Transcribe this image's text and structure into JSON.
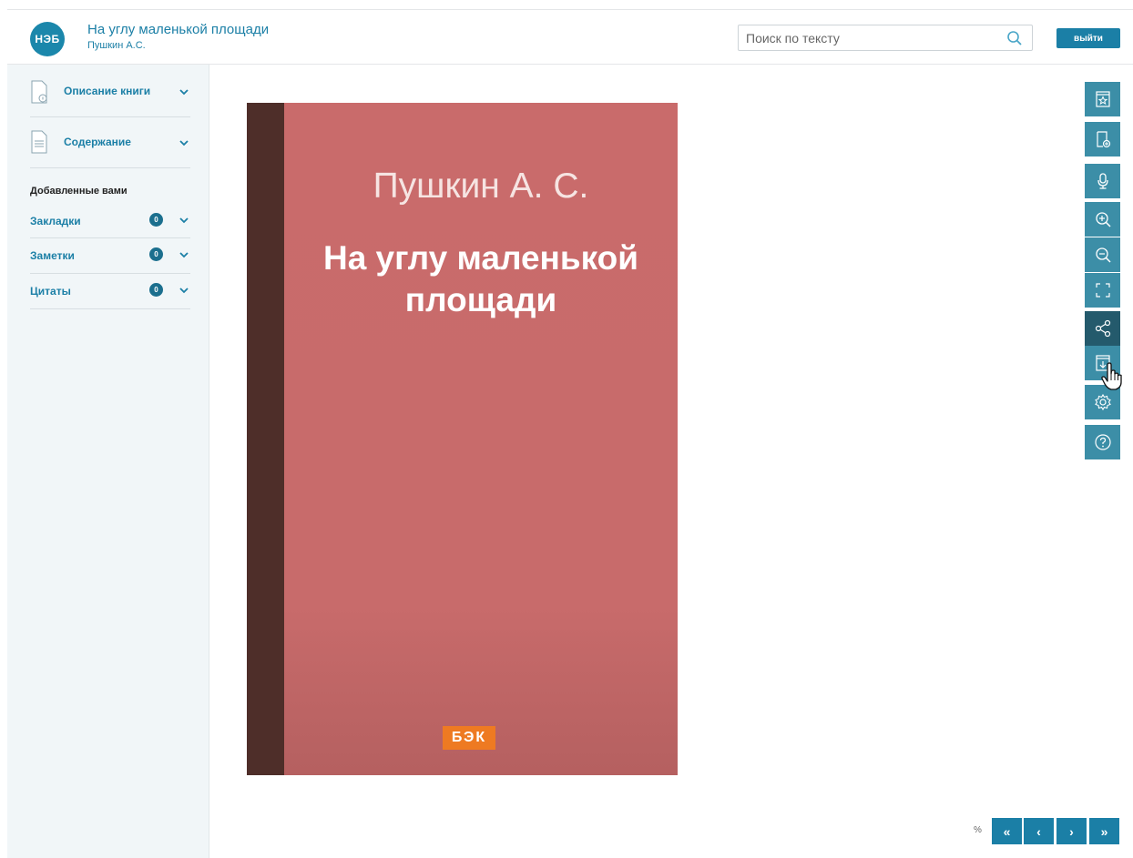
{
  "header": {
    "logo_text": "НЭБ",
    "book_title": "На углу маленькой площади",
    "book_author": "Пушкин А.С.",
    "search_placeholder": "Поиск по тексту",
    "logout_label": "выйти"
  },
  "sidebar": {
    "sections": [
      {
        "label": "Описание книги",
        "icon": "document-info-icon"
      },
      {
        "label": "Содержание",
        "icon": "document-list-icon"
      }
    ],
    "user_heading": "Добавленные вами",
    "user_items": [
      {
        "label": "Закладки",
        "count": "0"
      },
      {
        "label": "Заметки",
        "count": "0"
      },
      {
        "label": "Цитаты",
        "count": "0"
      }
    ]
  },
  "cover": {
    "author": "Пушкин А. С.",
    "title": "На углу маленькой площади",
    "publisher": "БЭК"
  },
  "toolbar": [
    {
      "name": "bookmark-star-icon"
    },
    {
      "name": "add-bookmark-icon"
    },
    {
      "name": "microphone-icon"
    },
    {
      "name": "zoom-in-icon"
    },
    {
      "name": "zoom-out-icon"
    },
    {
      "name": "fullscreen-icon"
    },
    {
      "name": "share-icon",
      "active": true
    },
    {
      "name": "download-icon"
    },
    {
      "name": "settings-icon"
    },
    {
      "name": "help-icon"
    }
  ],
  "pagination": {
    "percent_label": "%",
    "first": "«",
    "prev": "‹",
    "next": "›",
    "last": "»"
  },
  "colors": {
    "accent": "#1b7fa6",
    "toolbar": "#3c8ea7",
    "toolbar_active": "#245a6c",
    "cover": "#c86b6b",
    "spine": "#4e2e29",
    "publisher": "#ee7a22"
  }
}
